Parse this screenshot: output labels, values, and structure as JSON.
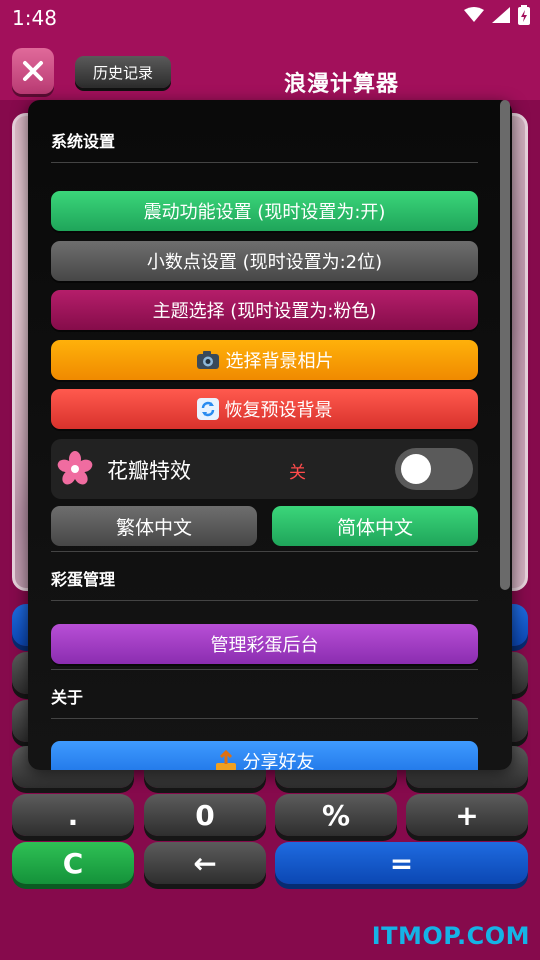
{
  "status_bar": {
    "time": "1:48"
  },
  "header": {
    "history_label": "历史记录",
    "app_title": "浪漫计算器"
  },
  "keypad": {
    "row_upper": [
      "",
      "",
      "",
      ""
    ],
    "row_dot": [
      ".",
      "0",
      "%",
      "+"
    ],
    "row_bottom": [
      "C",
      "←",
      "="
    ]
  },
  "settings": {
    "system_title": "系统设置",
    "vibration_label": "震动功能设置 (现时设置为:开)",
    "decimal_label": "小数点设置 (现时设置为:2位)",
    "theme_label": "主题选择 (现时设置为:粉色)",
    "bg_photo_label": "选择背景相片",
    "reset_bg_label": "恢复预设背景",
    "petal_label": "花瓣特效",
    "petal_state": "关",
    "petal_enabled": false,
    "trad_chinese_label": "繁体中文",
    "simp_chinese_label": "简体中文",
    "easter_title": "彩蛋管理",
    "easter_admin_label": "管理彩蛋后台",
    "about_title": "关于",
    "share_label": "分享好友"
  },
  "watermark": "ITMOP.COM"
}
